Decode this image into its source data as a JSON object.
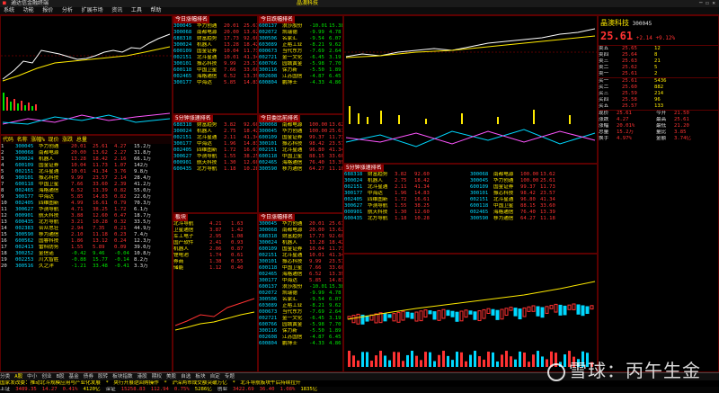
{
  "app": {
    "title": "通达信金融终端"
  },
  "menu": [
    "系统",
    "功能",
    "报价",
    "分析",
    "扩展市场",
    "资讯",
    "工具",
    "帮助"
  ],
  "stock": {
    "name": "晶澳科技",
    "code": "300045",
    "price": "25.61",
    "change": "+2.14",
    "pct": "+9.12%"
  },
  "quotes": {
    "header": {
      "idx": "",
      "code": "代码",
      "name": "名称",
      "pct": "涨幅%",
      "price": "现价",
      "chg": "涨跌",
      "vol": "总量"
    },
    "rows": [
      {
        "idx": "1",
        "code": "300045",
        "name": "华力创通",
        "pct": "20.01",
        "price": "25.61",
        "chg": "4.27",
        "vol": "15.2万"
      },
      {
        "idx": "2",
        "code": "300068",
        "name": "南都电源",
        "pct": "20.00",
        "price": "13.62",
        "chg": "2.27",
        "vol": "31.8万"
      },
      {
        "idx": "3",
        "code": "300024",
        "name": "机器人",
        "pct": "13.28",
        "price": "18.42",
        "chg": "2.16",
        "vol": "66.1万"
      },
      {
        "idx": "4",
        "code": "600109",
        "name": "国金证券",
        "pct": "10.04",
        "price": "11.73",
        "chg": "1.07",
        "vol": "142万"
      },
      {
        "idx": "5",
        "code": "002151",
        "name": "北斗星通",
        "pct": "10.01",
        "price": "41.34",
        "chg": "3.76",
        "vol": "9.8万"
      },
      {
        "idx": "6",
        "code": "300101",
        "name": "振芯科技",
        "pct": "9.99",
        "price": "23.57",
        "chg": "2.14",
        "vol": "28.4万"
      },
      {
        "idx": "7",
        "code": "600118",
        "name": "中国卫星",
        "pct": "7.66",
        "price": "33.60",
        "chg": "2.39",
        "vol": "41.2万"
      },
      {
        "idx": "8",
        "code": "002465",
        "name": "海格通信",
        "pct": "6.52",
        "price": "13.39",
        "chg": "0.82",
        "vol": "55.0万"
      },
      {
        "idx": "9",
        "code": "300177",
        "name": "中海达",
        "pct": "5.85",
        "price": "14.83",
        "chg": "0.82",
        "vol": "22.6万"
      },
      {
        "idx": "10",
        "code": "002405",
        "name": "四维图新",
        "pct": "4.99",
        "price": "16.61",
        "chg": "0.79",
        "vol": "70.3万"
      },
      {
        "idx": "11",
        "code": "300627",
        "name": "华测导航",
        "pct": "4.71",
        "price": "38.25",
        "chg": "1.72",
        "vol": "6.1万"
      },
      {
        "idx": "12",
        "code": "000901",
        "name": "航天科技",
        "pct": "3.88",
        "price": "12.60",
        "chg": "0.47",
        "vol": "18.7万"
      },
      {
        "idx": "13",
        "code": "600435",
        "name": "北方导航",
        "pct": "3.21",
        "price": "10.28",
        "chg": "0.32",
        "vol": "33.5万"
      },
      {
        "idx": "14",
        "code": "002383",
        "name": "合众思壮",
        "pct": "2.94",
        "price": "7.35",
        "chg": "0.21",
        "vol": "44.9万"
      },
      {
        "idx": "15",
        "code": "300590",
        "name": "移为通信",
        "pct": "2.10",
        "price": "11.18",
        "chg": "0.23",
        "vol": "7.4万"
      },
      {
        "idx": "16",
        "code": "600562",
        "name": "国睿科技",
        "pct": "1.86",
        "price": "13.12",
        "chg": "0.24",
        "vol": "12.3万"
      },
      {
        "idx": "17",
        "code": "002413",
        "name": "雷科防务",
        "pct": "1.55",
        "price": "5.89",
        "chg": "0.09",
        "vol": "39.0万"
      },
      {
        "idx": "18",
        "code": "300252",
        "name": "金信诺",
        "pct": "-0.42",
        "price": "9.46",
        "chg": "-0.04",
        "vol": "10.8万"
      },
      {
        "idx": "19",
        "code": "002253",
        "name": "川大智胜",
        "pct": "-0.88",
        "price": "15.77",
        "chg": "-0.14",
        "vol": "8.2万"
      },
      {
        "idx": "20",
        "code": "300516",
        "name": "久之洋",
        "pct": "-1.21",
        "price": "33.48",
        "chg": "-0.41",
        "vol": "3.3万"
      }
    ]
  },
  "rank_panels": [
    {
      "title": "今日涨幅排名",
      "rows": [
        {
          "code": "300045",
          "name": "华力创通",
          "pct": "20.01",
          "price": "25.61"
        },
        {
          "code": "300068",
          "name": "南都电源",
          "pct": "20.00",
          "price": "13.62"
        },
        {
          "code": "688318",
          "name": "财富趋势",
          "pct": "17.73",
          "price": "92.60"
        },
        {
          "code": "300024",
          "name": "机器人",
          "pct": "13.28",
          "price": "18.42"
        },
        {
          "code": "600109",
          "name": "国金证券",
          "pct": "10.04",
          "price": "11.73"
        },
        {
          "code": "002151",
          "name": "北斗星通",
          "pct": "10.01",
          "price": "41.34"
        },
        {
          "code": "300101",
          "name": "振芯科技",
          "pct": "9.99",
          "price": "23.57"
        },
        {
          "code": "600118",
          "name": "中国卫星",
          "pct": "7.66",
          "price": "33.60"
        },
        {
          "code": "002465",
          "name": "海格通信",
          "pct": "6.52",
          "price": "13.39"
        },
        {
          "code": "300177",
          "name": "中海达",
          "pct": "5.85",
          "price": "14.83"
        }
      ]
    },
    {
      "title": "今日跌幅排名",
      "rows": [
        {
          "code": "600137",
          "name": "浪莎股份",
          "pct": "-10.01",
          "price": "15.38"
        },
        {
          "code": "002072",
          "name": "凯瑞德",
          "pct": "-9.99",
          "price": "4.78"
        },
        {
          "code": "300506",
          "name": "名家汇",
          "pct": "-9.54",
          "price": "6.07"
        },
        {
          "code": "603089",
          "name": "正裕工业",
          "pct": "-8.21",
          "price": "9.62"
        },
        {
          "code": "000673",
          "name": "当代东方",
          "pct": "-7.69",
          "price": "2.64"
        },
        {
          "code": "002721",
          "name": "金一文化",
          "pct": "-6.45",
          "price": "3.19"
        },
        {
          "code": "600766",
          "name": "园城黄金",
          "pct": "-5.98",
          "price": "7.70"
        },
        {
          "code": "300116",
          "name": "保力新",
          "pct": "-5.50",
          "price": "1.89"
        },
        {
          "code": "002608",
          "name": "江苏国信",
          "pct": "-4.87",
          "price": "6.45"
        },
        {
          "code": "600804",
          "name": "鹏博士",
          "pct": "-4.33",
          "price": "4.86"
        }
      ]
    },
    {
      "title": "5分钟涨速排名",
      "rows": [
        {
          "code": "688318",
          "name": "财富趋势",
          "pct": "3.82",
          "price": "92.60"
        },
        {
          "code": "300024",
          "name": "机器人",
          "pct": "2.75",
          "price": "18.42"
        },
        {
          "code": "002151",
          "name": "北斗星通",
          "pct": "2.11",
          "price": "41.34"
        },
        {
          "code": "300177",
          "name": "中海达",
          "pct": "1.96",
          "price": "14.83"
        },
        {
          "code": "002405",
          "name": "四维图新",
          "pct": "1.72",
          "price": "16.61"
        },
        {
          "code": "300627",
          "name": "华测导航",
          "pct": "1.55",
          "price": "38.25"
        },
        {
          "code": "000901",
          "name": "航天科技",
          "pct": "1.30",
          "price": "12.60"
        },
        {
          "code": "600435",
          "name": "北方导航",
          "pct": "1.18",
          "price": "10.28"
        }
      ]
    },
    {
      "title": "今日委比前排名",
      "rows": [
        {
          "code": "300068",
          "name": "南都电源",
          "pct": "100.00",
          "price": "13.62"
        },
        {
          "code": "300045",
          "name": "华力创通",
          "pct": "100.00",
          "price": "25.61"
        },
        {
          "code": "600109",
          "name": "国金证券",
          "pct": "99.37",
          "price": "11.73"
        },
        {
          "code": "300101",
          "name": "振芯科技",
          "pct": "98.42",
          "price": "23.57"
        },
        {
          "code": "002151",
          "name": "北斗星通",
          "pct": "96.80",
          "price": "41.34"
        },
        {
          "code": "600118",
          "name": "中国卫星",
          "pct": "88.15",
          "price": "33.60"
        },
        {
          "code": "002465",
          "name": "海格通信",
          "pct": "76.40",
          "price": "13.39"
        },
        {
          "code": "300590",
          "name": "移为通信",
          "pct": "64.27",
          "price": "11.18"
        }
      ]
    }
  ],
  "sector": {
    "title": "板块",
    "rows": [
      {
        "name": "北斗导航",
        "pct": "4.21",
        "val": "1.63"
      },
      {
        "name": "卫星通信",
        "pct": "3.87",
        "val": "1.42"
      },
      {
        "name": "军工电子",
        "pct": "2.95",
        "val": "1.08"
      },
      {
        "name": "国产软件",
        "pct": "2.41",
        "val": "0.93"
      },
      {
        "name": "机器人",
        "pct": "2.06",
        "val": "0.87"
      },
      {
        "name": "锂电池",
        "pct": "1.74",
        "val": "0.61"
      },
      {
        "name": "券商",
        "pct": "1.38",
        "val": "0.55"
      },
      {
        "name": "储能",
        "pct": "1.12",
        "val": "0.40"
      }
    ]
  },
  "orderbook": {
    "sell": [
      [
        "卖五",
        "25.65",
        "12"
      ],
      [
        "卖四",
        "25.64",
        "8"
      ],
      [
        "卖三",
        "25.63",
        "21"
      ],
      [
        "卖二",
        "25.62",
        "5"
      ],
      [
        "卖一",
        "25.61",
        "2"
      ]
    ],
    "buy": [
      [
        "买一",
        "25.61",
        "5436"
      ],
      [
        "买二",
        "25.60",
        "882"
      ],
      [
        "买三",
        "25.59",
        "214"
      ],
      [
        "买四",
        "25.58",
        "96"
      ],
      [
        "买五",
        "25.57",
        "133"
      ]
    ],
    "stats": [
      [
        "现价",
        "25.61"
      ],
      [
        "今开",
        "21.50"
      ],
      [
        "涨跌",
        "4.27"
      ],
      [
        "最高",
        "25.61"
      ],
      [
        "涨幅",
        "20.01%"
      ],
      [
        "最低",
        "21.20"
      ],
      [
        "总量",
        "15.2万"
      ],
      [
        "量比",
        "3.85"
      ],
      [
        "换手",
        "4.97%"
      ],
      [
        "金额",
        "3.74亿"
      ]
    ]
  },
  "tabs": [
    "分类",
    "A股",
    "中小",
    "创业",
    "B股",
    "基金",
    "债券",
    "股转",
    "板块指数",
    "港股",
    "期权",
    "美股",
    "自选",
    "板块",
    "自定",
    "专题"
  ],
  "ticker": "国家发改委：推动北斗规模应用与产业化发展　*　央行开展逆回购操作　*　沪深两市成交额突破万亿　*　北斗导航板块午后持续拉升",
  "status": [
    {
      "label": "上证",
      "value": "3489.35",
      "chg": "14.27",
      "pct": "0.41%",
      "amt": "4120亿"
    },
    {
      "label": "深证",
      "value": "15258.83",
      "chg": "112.94",
      "pct": "0.75%",
      "amt": "5286亿"
    },
    {
      "label": "创业",
      "value": "3422.69",
      "chg": "36.40",
      "pct": "1.08%",
      "amt": "1835亿"
    }
  ],
  "watermark": {
    "text": "雪球：丙午生金"
  }
}
